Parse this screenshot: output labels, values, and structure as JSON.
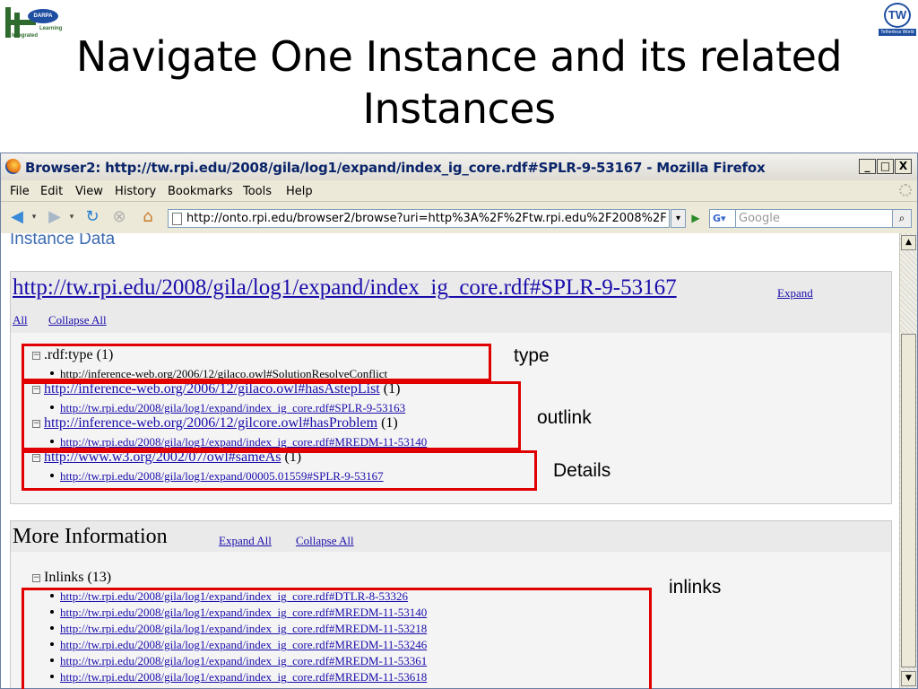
{
  "slide": {
    "title": "Navigate One Instance and its related Instances",
    "logo_left_badge": "DARPA",
    "logo_left_text1": "Learning",
    "logo_left_text2": "Integrated",
    "logo_right_mark": "TW",
    "logo_right_text": "Tetherless World"
  },
  "window": {
    "title": "Browser2: http://tw.rpi.edu/2008/gila/log1/expand/index_ig_core.rdf#SPLR-9-53167 - Mozilla Firefox",
    "minimize": "_",
    "maximize": "□",
    "close": "X"
  },
  "menu": [
    "File",
    "Edit",
    "View",
    "History",
    "Bookmarks",
    "Tools",
    "Help"
  ],
  "toolbar": {
    "url": "http://onto.rpi.edu/browser2/browse?uri=http%3A%2F%2Ftw.rpi.edu%2F2008%2F",
    "search_engine": "G",
    "search_placeholder": "Google"
  },
  "instance": {
    "heading": "Instance Data",
    "uri": "http://tw.rpi.edu/2008/gila/log1/expand/index_ig_core.rdf#SPLR-9-53167",
    "expand_all_part1": "Expand",
    "expand_all_part2": "All",
    "collapse_all": "Collapse All",
    "properties": [
      {
        "label": ".rdf:type",
        "count": "(1)",
        "is_link": false,
        "value": "http://inference-web.org/2006/12/gilaco.owl#SolutionResolveConflict",
        "value_link": false
      },
      {
        "label": "http://inference-web.org/2006/12/gilaco.owl#hasAstepList",
        "count": "(1)",
        "is_link": true,
        "value": "http://tw.rpi.edu/2008/gila/log1/expand/index_ig_core.rdf#SPLR-9-53163",
        "value_link": true
      },
      {
        "label": "http://inference-web.org/2006/12/gilcore.owl#hasProblem",
        "count": "(1)",
        "is_link": true,
        "value": "http://tw.rpi.edu/2008/gila/log1/expand/index_ig_core.rdf#MREDM-11-53140",
        "value_link": true
      },
      {
        "label": "http://www.w3.org/2002/07/owl#sameAs",
        "count": "(1)",
        "is_link": true,
        "value": "http://tw.rpi.edu/2008/gila/log1/expand/00005.01559#SPLR-9-53167",
        "value_link": true
      }
    ]
  },
  "more_info": {
    "heading": "More Information",
    "expand_all": "Expand All",
    "collapse_all": "Collapse All",
    "inlinks_label": "Inlinks",
    "inlinks_count": "(13)",
    "inlinks": [
      "http://tw.rpi.edu/2008/gila/log1/expand/index_ig_core.rdf#DTLR-8-53326",
      "http://tw.rpi.edu/2008/gila/log1/expand/index_ig_core.rdf#MREDM-11-53140",
      "http://tw.rpi.edu/2008/gila/log1/expand/index_ig_core.rdf#MREDM-11-53218",
      "http://tw.rpi.edu/2008/gila/log1/expand/index_ig_core.rdf#MREDM-11-53246",
      "http://tw.rpi.edu/2008/gila/log1/expand/index_ig_core.rdf#MREDM-11-53361",
      "http://tw.rpi.edu/2008/gila/log1/expand/index_ig_core.rdf#MREDM-11-53618"
    ]
  },
  "annotations": {
    "type": "type",
    "outlink": "outlink",
    "details": "Details",
    "inlinks": "inlinks",
    "box_color": "#e00000"
  }
}
